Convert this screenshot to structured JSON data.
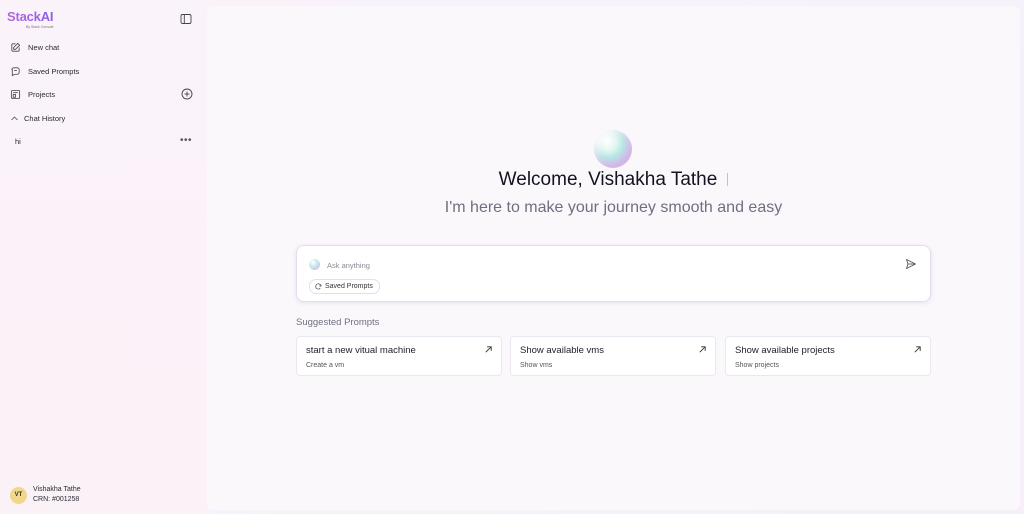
{
  "app": {
    "logo_main": "StackAI",
    "logo_sub": "By Stack Console"
  },
  "sidebar": {
    "items": [
      {
        "label": "New chat",
        "icon": "edit-icon"
      },
      {
        "label": "Saved Prompts",
        "icon": "prompt-icon"
      },
      {
        "label": "Projects",
        "icon": "projects-icon"
      }
    ],
    "chat_history_label": "Chat History",
    "history": [
      {
        "label": "hi"
      }
    ],
    "more_label": "•••"
  },
  "user": {
    "initials": "VT",
    "name": "Vishakha Tathe",
    "crn": "CRN: #001258"
  },
  "main": {
    "welcome": "Welcome, Vishakha Tathe",
    "subtitle": "I'm here to make your journey smooth and easy",
    "chat": {
      "placeholder": "Ask anything",
      "value": "",
      "saved_prompts_label": "Saved Prompts"
    },
    "suggested_title": "Suggested Prompts",
    "cards": [
      {
        "title": "start a new vitual machine",
        "subtitle": "Create a vm"
      },
      {
        "title": "Show available vms",
        "subtitle": "Show vms"
      },
      {
        "title": "Show available projects",
        "subtitle": "Show projects"
      }
    ]
  },
  "colors": {
    "brand_gradient_start": "#b06ad8",
    "brand_gradient_end": "#8a5cf0",
    "avatar_bg": "#f1d78a",
    "cursor": "#e6c55a"
  }
}
